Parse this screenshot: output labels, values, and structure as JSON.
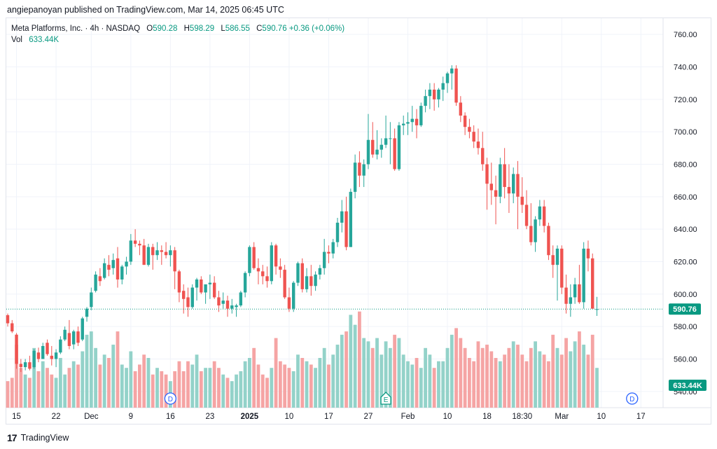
{
  "header": {
    "published": "angiepanoyan published on TradingView.com, Mar 14, 2025 06:45 UTC"
  },
  "legend": {
    "symbol": "Meta Platforms, Inc. · 4h · NASDAQ",
    "open_label": "O",
    "open": "590.28",
    "high_label": "H",
    "high": "598.29",
    "low_label": "L",
    "low": "586.55",
    "close_label": "C",
    "close": "590.76",
    "change": "+0.36 (+0.06%)",
    "vol_label": "Vol",
    "vol_value": "633.44K"
  },
  "footer": {
    "logo": "17",
    "brand": "TradingView"
  },
  "colors": {
    "up": "#26a69a",
    "down": "#ef5350",
    "vol_up": "#93d2c9",
    "vol_down": "#f5a4a4",
    "grid": "#f0f3fa",
    "axis_text": "#131722",
    "price_badge": "#089981",
    "event_blue": "#2962ff",
    "event_green": "#089981"
  },
  "chart_data": {
    "type": "candlestick",
    "title": "Meta Platforms, Inc. · 4h · NASDAQ",
    "ylim": [
      530,
      770
    ],
    "y_ticks": [
      540,
      560,
      580,
      600,
      620,
      640,
      660,
      680,
      700,
      720,
      740,
      760
    ],
    "y_tick_labels": [
      "540.00",
      "560.00",
      "580.00",
      "600.00",
      "620.00",
      "640.00",
      "660.00",
      "680.00",
      "700.00",
      "720.00",
      "740.00",
      "760.00"
    ],
    "x_ticks": [
      {
        "label": "15",
        "bar": 2
      },
      {
        "label": "22",
        "bar": 11
      },
      {
        "label": "Dec",
        "bar": 19
      },
      {
        "label": "9",
        "bar": 28
      },
      {
        "label": "16",
        "bar": 37
      },
      {
        "label": "23",
        "bar": 46
      },
      {
        "label": "2025",
        "bar": 55
      },
      {
        "label": "10",
        "bar": 64
      },
      {
        "label": "17",
        "bar": 73
      },
      {
        "label": "27",
        "bar": 82
      },
      {
        "label": "Feb",
        "bar": 91
      },
      {
        "label": "10",
        "bar": 100
      },
      {
        "label": "18",
        "bar": 109
      },
      {
        "label": "18:30",
        "bar": 117
      },
      {
        "label": "Mar",
        "bar": 126
      },
      {
        "label": "10",
        "bar": 135
      },
      {
        "label": "17",
        "bar": 144
      }
    ],
    "last_price": 590.76,
    "last_price_label": "590.76",
    "last_volume_label": "633.44K",
    "events": [
      {
        "bar": 37,
        "label": "D",
        "kind": "dividend"
      },
      {
        "bar": 86,
        "label": "E",
        "kind": "earnings"
      },
      {
        "bar": 142,
        "label": "D",
        "kind": "dividend"
      }
    ],
    "candles": [
      [
        587,
        588,
        580,
        582,
        8
      ],
      [
        582,
        584,
        576,
        577,
        9
      ],
      [
        575,
        576,
        554,
        557,
        19
      ],
      [
        557,
        560,
        552,
        555,
        12
      ],
      [
        555,
        560,
        553,
        558,
        10
      ],
      [
        558,
        562,
        553,
        554,
        9
      ],
      [
        555,
        566,
        554,
        565,
        18
      ],
      [
        564,
        567,
        558,
        560,
        11
      ],
      [
        560,
        570,
        560,
        568,
        14
      ],
      [
        570,
        572,
        562,
        563,
        12
      ],
      [
        562,
        568,
        556,
        560,
        10
      ],
      [
        560,
        566,
        555,
        564,
        9
      ],
      [
        564,
        574,
        563,
        572,
        15
      ],
      [
        572,
        580,
        571,
        578,
        10
      ],
      [
        576,
        584,
        566,
        568,
        12
      ],
      [
        569,
        578,
        566,
        577,
        14
      ],
      [
        577,
        580,
        568,
        570,
        13
      ],
      [
        572,
        586,
        571,
        585,
        17
      ],
      [
        586,
        592,
        583,
        591,
        22
      ],
      [
        592,
        604,
        590,
        601,
        23
      ],
      [
        602,
        614,
        601,
        612,
        18
      ],
      [
        611,
        616,
        605,
        608,
        13
      ],
      [
        610,
        622,
        609,
        619,
        16
      ],
      [
        618,
        624,
        611,
        615,
        15
      ],
      [
        616,
        625,
        612,
        621,
        19
      ],
      [
        622,
        629,
        604,
        609,
        23
      ],
      [
        609,
        618,
        606,
        617,
        13
      ],
      [
        617,
        623,
        612,
        620,
        12
      ],
      [
        620,
        637,
        618,
        633,
        17
      ],
      [
        633,
        640,
        629,
        631,
        11
      ],
      [
        631,
        633,
        624,
        630,
        13
      ],
      [
        630,
        634,
        618,
        618,
        16
      ],
      [
        618,
        631,
        617,
        629,
        15
      ],
      [
        629,
        631,
        615,
        624,
        10
      ],
      [
        624,
        632,
        621,
        627,
        12
      ],
      [
        627,
        630,
        618,
        626,
        11
      ],
      [
        626,
        632,
        622,
        624,
        10
      ],
      [
        624,
        630,
        617,
        627,
        8
      ],
      [
        627,
        629,
        603,
        614,
        11
      ],
      [
        614,
        615,
        595,
        601,
        14
      ],
      [
        602,
        606,
        588,
        597,
        11
      ],
      [
        598,
        604,
        586,
        592,
        14
      ],
      [
        592,
        606,
        591,
        604,
        13
      ],
      [
        604,
        610,
        596,
        609,
        16
      ],
      [
        609,
        611,
        600,
        601,
        11
      ],
      [
        601,
        606,
        594,
        606,
        12
      ],
      [
        606,
        612,
        597,
        607,
        12
      ],
      [
        607,
        611,
        597,
        598,
        14
      ],
      [
        598,
        602,
        589,
        593,
        12
      ],
      [
        594,
        601,
        591,
        596,
        10
      ],
      [
        596,
        599,
        586,
        591,
        9
      ],
      [
        591,
        597,
        588,
        593,
        8
      ],
      [
        592,
        594,
        586,
        593,
        10
      ],
      [
        593,
        602,
        592,
        601,
        11
      ],
      [
        601,
        614,
        598,
        613,
        14
      ],
      [
        613,
        630,
        611,
        629,
        15
      ],
      [
        629,
        632,
        615,
        616,
        18
      ],
      [
        616,
        622,
        606,
        614,
        13
      ],
      [
        614,
        618,
        606,
        611,
        10
      ],
      [
        611,
        617,
        604,
        608,
        9
      ],
      [
        608,
        632,
        606,
        630,
        12
      ],
      [
        630,
        631,
        612,
        617,
        21
      ],
      [
        617,
        622,
        610,
        615,
        14
      ],
      [
        615,
        618,
        597,
        598,
        13
      ],
      [
        598,
        604,
        589,
        591,
        12
      ],
      [
        591,
        608,
        589,
        607,
        11
      ],
      [
        607,
        620,
        605,
        619,
        16
      ],
      [
        619,
        622,
        601,
        603,
        15
      ],
      [
        603,
        616,
        601,
        611,
        14
      ],
      [
        611,
        618,
        599,
        605,
        13
      ],
      [
        605,
        614,
        602,
        612,
        12
      ],
      [
        612,
        618,
        609,
        616,
        15
      ],
      [
        616,
        634,
        612,
        626,
        18
      ],
      [
        626,
        630,
        619,
        625,
        13
      ],
      [
        625,
        634,
        622,
        632,
        16
      ],
      [
        632,
        647,
        629,
        644,
        19
      ],
      [
        644,
        658,
        638,
        651,
        22
      ],
      [
        651,
        660,
        627,
        629,
        23
      ],
      [
        629,
        665,
        629,
        663,
        28
      ],
      [
        663,
        686,
        659,
        681,
        25
      ],
      [
        681,
        688,
        666,
        673,
        29
      ],
      [
        673,
        683,
        666,
        680,
        21
      ],
      [
        680,
        711,
        677,
        695,
        20
      ],
      [
        695,
        706,
        684,
        686,
        18
      ],
      [
        686,
        701,
        683,
        689,
        21
      ],
      [
        689,
        696,
        684,
        692,
        16
      ],
      [
        692,
        710,
        690,
        696,
        20
      ],
      [
        696,
        706,
        680,
        696,
        18
      ],
      [
        696,
        702,
        676,
        677,
        22
      ],
      [
        677,
        706,
        676,
        704,
        21
      ],
      [
        704,
        710,
        698,
        705,
        16
      ],
      [
        705,
        712,
        698,
        706,
        14
      ],
      [
        706,
        716,
        700,
        708,
        13
      ],
      [
        708,
        714,
        696,
        704,
        15
      ],
      [
        704,
        718,
        703,
        716,
        12
      ],
      [
        716,
        726,
        712,
        722,
        18
      ],
      [
        722,
        730,
        714,
        726,
        16
      ],
      [
        726,
        730,
        713,
        720,
        12
      ],
      [
        720,
        727,
        715,
        726,
        14
      ],
      [
        726,
        734,
        719,
        730,
        14
      ],
      [
        730,
        737,
        724,
        736,
        18
      ],
      [
        736,
        741,
        726,
        739,
        22
      ],
      [
        739,
        741,
        716,
        718,
        24
      ],
      [
        718,
        722,
        706,
        710,
        21
      ],
      [
        710,
        712,
        698,
        703,
        18
      ],
      [
        703,
        708,
        696,
        700,
        15
      ],
      [
        700,
        704,
        690,
        694,
        14
      ],
      [
        694,
        702,
        686,
        690,
        20
      ],
      [
        690,
        700,
        676,
        680,
        18
      ],
      [
        680,
        684,
        652,
        668,
        19
      ],
      [
        668,
        681,
        655,
        664,
        17
      ],
      [
        664,
        673,
        643,
        660,
        15
      ],
      [
        660,
        684,
        656,
        680,
        14
      ],
      [
        680,
        690,
        659,
        666,
        16
      ],
      [
        666,
        680,
        650,
        662,
        18
      ],
      [
        662,
        678,
        656,
        674,
        20
      ],
      [
        674,
        682,
        640,
        660,
        19
      ],
      [
        660,
        672,
        650,
        655,
        16
      ],
      [
        655,
        664,
        640,
        642,
        14
      ],
      [
        642,
        656,
        630,
        632,
        18
      ],
      [
        632,
        648,
        626,
        646,
        20
      ],
      [
        646,
        658,
        642,
        654,
        17
      ],
      [
        654,
        658,
        638,
        642,
        16
      ],
      [
        642,
        644,
        621,
        624,
        14
      ],
      [
        624,
        630,
        610,
        618,
        22
      ],
      [
        618,
        630,
        596,
        628,
        18
      ],
      [
        628,
        630,
        600,
        604,
        16
      ],
      [
        604,
        612,
        588,
        594,
        21
      ],
      [
        594,
        606,
        586,
        598,
        17
      ],
      [
        598,
        610,
        594,
        606,
        20
      ],
      [
        606,
        618,
        594,
        595,
        23
      ],
      [
        595,
        632,
        591,
        628,
        19
      ],
      [
        628,
        633,
        614,
        622,
        16
      ],
      [
        622,
        625,
        592,
        591,
        22
      ],
      [
        590.28,
        598.29,
        586.55,
        590.76,
        12
      ]
    ]
  }
}
